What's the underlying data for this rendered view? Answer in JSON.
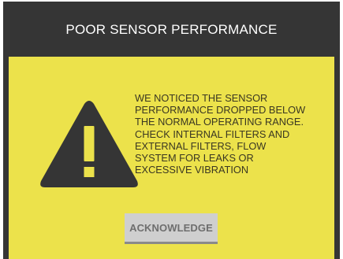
{
  "dialog": {
    "title": "POOR SENSOR PERFORMANCE",
    "message": "WE NOTICED THE SENSOR\nPERFORMANCE DROPPED BELOW\nTHE NORMAL OPERATING RANGE.\nCHECK INTERNAL FILTERS AND\nEXTERNAL FILTERS, FLOW\nSYSTEM FOR LEAKS OR\nEXCESSIVE VIBRATION",
    "icon": "warning-triangle-icon",
    "acknowledge_label": "ACKNOWLEDGE"
  },
  "colors": {
    "frame": "#353535",
    "panel": "#ece24b",
    "title_text": "#ffffff",
    "message_text": "#3a3722",
    "button_bg": "#cfcfcf",
    "button_text": "#6e6e6e"
  }
}
